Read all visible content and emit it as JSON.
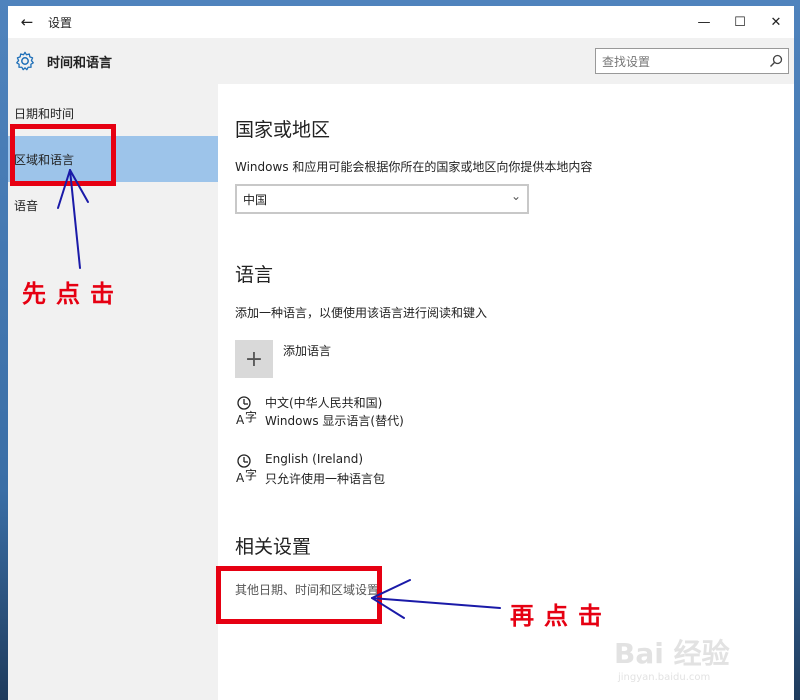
{
  "window": {
    "title": "设置",
    "back_icon": "back-arrow-icon",
    "minimize_icon": "minimize-icon",
    "maximize_icon": "maximize-icon",
    "close_icon": "close-icon"
  },
  "header": {
    "icon": "gear-icon",
    "title": "时间和语言",
    "search_placeholder": "查找设置",
    "search_icon": "search-icon"
  },
  "sidebar": {
    "items": [
      {
        "label": "日期和时间"
      },
      {
        "label": "区域和语言",
        "selected": true
      },
      {
        "label": "语音"
      }
    ],
    "selected_color": "#9dc4ea"
  },
  "content": {
    "region": {
      "heading": "国家或地区",
      "description": "Windows 和应用可能会根据你所在的国家或地区向你提供本地内容",
      "selected_value": "中国"
    },
    "language": {
      "heading": "语言",
      "description": "添加一种语言，以便使用该语言进行阅读和键入",
      "add_label": "添加语言",
      "items": [
        {
          "name": "中文(中华人民共和国)",
          "sub": "Windows 显示语言(替代)",
          "icon": "language-icon"
        },
        {
          "name": "English (Ireland)",
          "sub": "只允许使用一种语言包",
          "icon": "language-icon"
        }
      ]
    },
    "related": {
      "heading": "相关设置",
      "link": "其他日期、时间和区域设置"
    }
  },
  "annotations": {
    "first_click": "先点击",
    "then_click": "再点击",
    "color": "#e60012",
    "arrow_color": "#1a1aa8"
  },
  "watermark": {
    "main": "Bai 经验",
    "sub": "jingyan.baidu.com"
  }
}
